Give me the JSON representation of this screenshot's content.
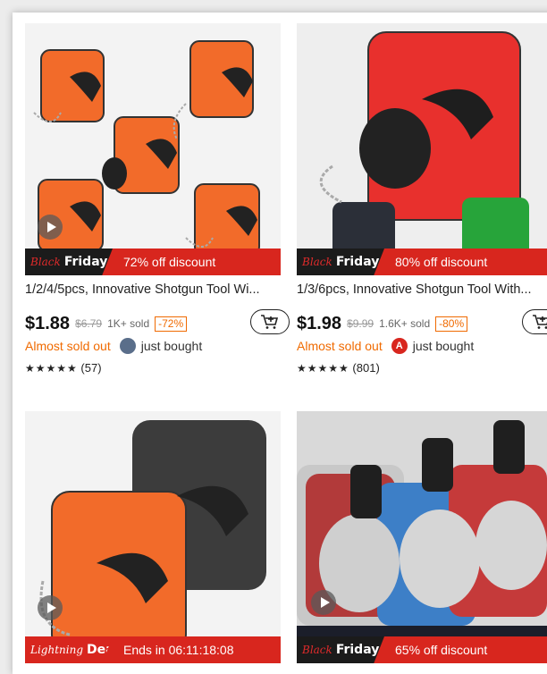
{
  "products": [
    {
      "badge_label": "Black",
      "badge_label2": "Friday",
      "discount": "72% off discount",
      "title": "1/2/4/5pcs, Innovative Shotgun Tool Wi...",
      "price": "$1.88",
      "original_price": "$6.79",
      "sold": "1K+ sold",
      "discount_pct": "-72%",
      "stock_status": "Almost sold out",
      "activity": "just bought",
      "stars": "★★★★★",
      "rating_count": "(57)"
    },
    {
      "badge_label": "Black",
      "badge_label2": "Friday",
      "discount": "80% off discount",
      "title": "1/3/6pcs, Innovative Shotgun Tool With...",
      "price": "$1.98",
      "original_price": "$9.99",
      "sold": "1.6K+ sold",
      "discount_pct": "-80%",
      "stock_status": "Almost sold out",
      "avatar_letter": "A",
      "activity": "just bought",
      "stars": "★★★★★",
      "rating_count": "(801)"
    },
    {
      "badge_label": "Lightning",
      "badge_label2": "Deal",
      "countdown": "Ends in 06:11:18:08"
    },
    {
      "badge_label": "Black",
      "badge_label2": "Friday",
      "discount": "65% off discount"
    }
  ],
  "colors": {
    "accent": "#d8261e",
    "orange": "#f06a00",
    "banner_dark": "#1b1b1b"
  }
}
